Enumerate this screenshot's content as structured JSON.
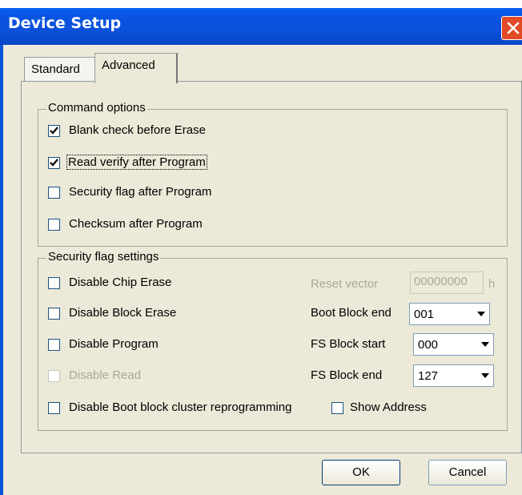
{
  "window": {
    "title": "Device Setup",
    "close_icon": "close-icon"
  },
  "tabs": [
    {
      "label": "Standard",
      "selected": false
    },
    {
      "label": "Advanced",
      "selected": true
    }
  ],
  "command_options": {
    "legend": "Command options",
    "items": [
      {
        "label": "Blank check before Erase",
        "checked": true
      },
      {
        "label": "Read verify after Program",
        "checked": true
      },
      {
        "label": "Security flag after Program",
        "checked": false
      },
      {
        "label": "Checksum after Program",
        "checked": false
      }
    ]
  },
  "security_flag_settings": {
    "legend": "Security flag settings",
    "items": [
      {
        "label": "Disable Chip Erase",
        "checked": false,
        "enabled": true
      },
      {
        "label": "Disable Block Erase",
        "checked": false,
        "enabled": true
      },
      {
        "label": "Disable Program",
        "checked": false,
        "enabled": true
      },
      {
        "label": "Disable Read",
        "checked": false,
        "enabled": false
      },
      {
        "label": "Disable Boot block cluster reprogramming",
        "checked": false,
        "enabled": true
      }
    ],
    "reset_vector": {
      "label": "Reset vector",
      "value": "00000000",
      "suffix": "h",
      "enabled": false
    },
    "boot_block_end": {
      "label": "Boot Block end",
      "value": "001"
    },
    "fs_block_start": {
      "label": "FS Block start",
      "value": "000"
    },
    "fs_block_end": {
      "label": "FS Block end",
      "value": "127"
    },
    "show_address": {
      "label": "Show Address",
      "checked": false
    }
  },
  "buttons": {
    "ok": "OK",
    "cancel": "Cancel"
  }
}
